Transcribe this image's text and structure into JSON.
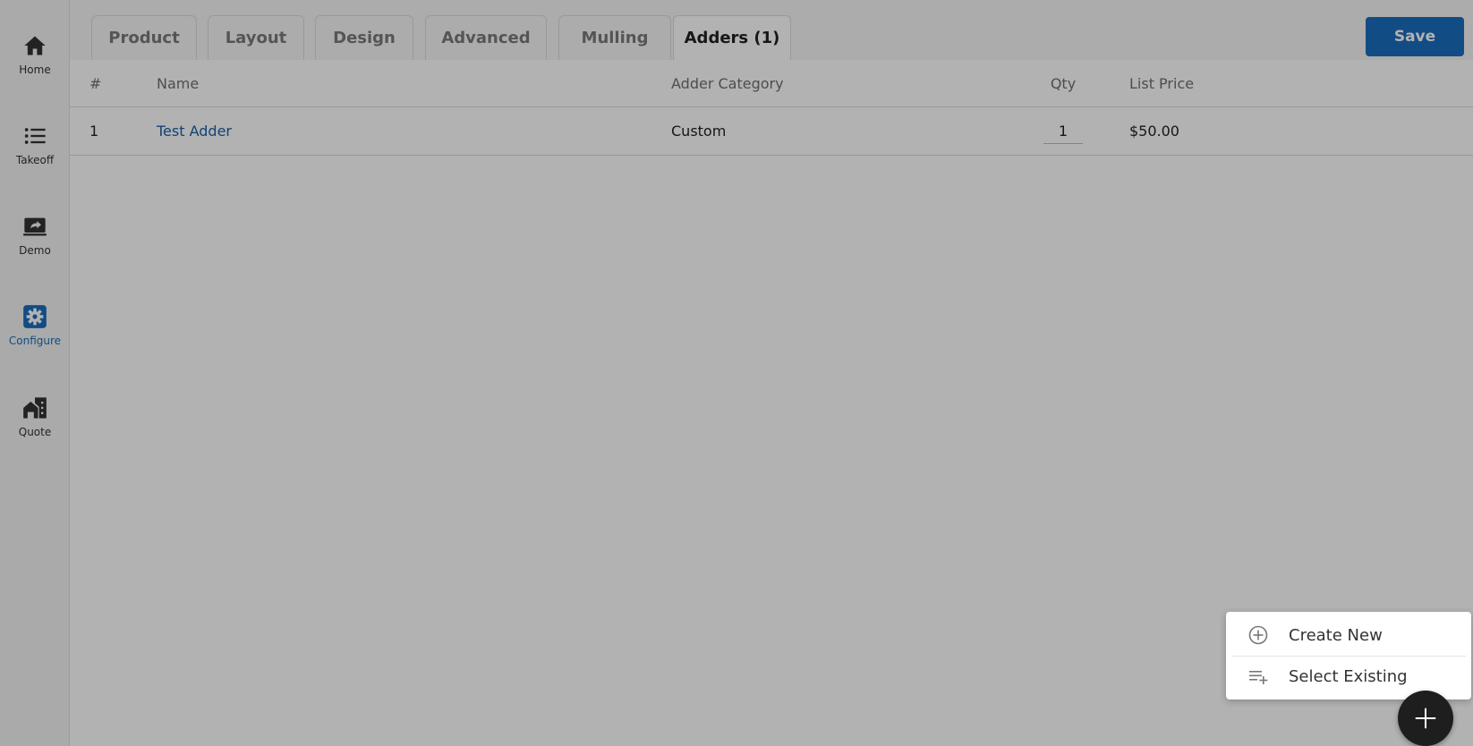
{
  "sidebar": {
    "items": [
      {
        "label": "Home",
        "icon": "home-icon"
      },
      {
        "label": "Takeoff",
        "icon": "list-icon"
      },
      {
        "label": "Demo",
        "icon": "share-screen-icon"
      },
      {
        "label": "Configure",
        "icon": "gear-icon",
        "active": true
      },
      {
        "label": "Quote",
        "icon": "house-building-icon"
      }
    ]
  },
  "tabs": [
    {
      "label": "Product"
    },
    {
      "label": "Layout"
    },
    {
      "label": "Design"
    },
    {
      "label": "Advanced"
    },
    {
      "label": "Mulling"
    },
    {
      "label": "Adders (1)",
      "active": true
    }
  ],
  "toolbar": {
    "save_label": "Save"
  },
  "table": {
    "headers": [
      "#",
      "Name",
      "Adder Category",
      "Qty",
      "List Price"
    ],
    "rows": [
      {
        "num": "1",
        "name": "Test Adder",
        "category": "Custom",
        "qty": "1",
        "price": "$50.00"
      }
    ]
  },
  "menu": {
    "items": [
      {
        "label": "Create New",
        "icon": "add-circle-icon"
      },
      {
        "label": "Select Existing",
        "icon": "playlist-add-icon"
      }
    ]
  },
  "colors": {
    "accent": "#1a6dbd",
    "link": "#1a5fa8",
    "fab": "#1e1e1e"
  }
}
